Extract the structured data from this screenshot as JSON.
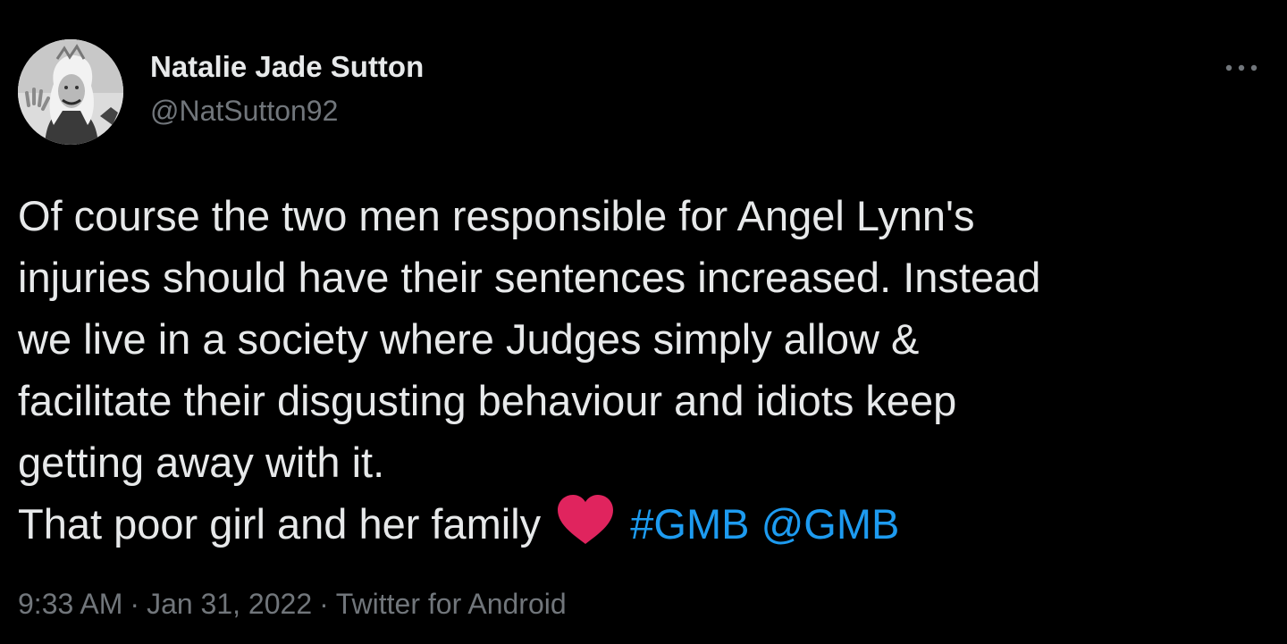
{
  "author": {
    "name": "Natalie Jade Sutton",
    "handle": "@NatSutton92",
    "avatar_icon": "profile-photo"
  },
  "more_icon": "more-options-icon",
  "tweet": {
    "lines": [
      "Of course the two men responsible for Angel Lynn's",
      "injuries should have their sentences increased. Instead",
      "we live in a society where Judges simply allow &",
      "facilitate their disgusting behaviour and idiots keep",
      "getting away with it."
    ],
    "last_line_text": "That poor girl and her family",
    "emoji": "heart-emoji",
    "hashtag": "#GMB",
    "mention": "@GMB"
  },
  "meta": {
    "time": "9:33 AM",
    "separator": "·",
    "date": "Jan 31, 2022",
    "source": "Twitter for Android"
  },
  "colors": {
    "background": "#000000",
    "text": "#e7e9ea",
    "muted": "#71767b",
    "link": "#1d9bf0",
    "heart": "#e0245e"
  }
}
